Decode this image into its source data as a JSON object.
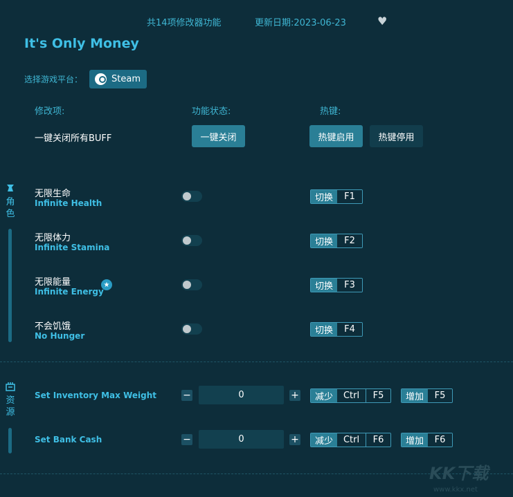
{
  "header": {
    "feature_count": "共14项修改器功能",
    "update_date": "更新日期:2023-06-23",
    "favorite_icon": "heart-icon"
  },
  "game_title": "It's Only Money",
  "platform": {
    "label": "选择游戏平台：",
    "selected": "Steam"
  },
  "columns": {
    "mod_item": "修改项:",
    "status": "功能状态:",
    "hotkey": "热键:"
  },
  "global": {
    "label": "一键关闭所有BUFF",
    "close_all": "一键关闭",
    "hotkey_enable": "热键启用",
    "hotkey_disable": "热键停用"
  },
  "categories": {
    "character": {
      "label_1": "角",
      "label_2": "色",
      "icon": "character-icon"
    },
    "resources": {
      "label_1": "资",
      "label_2": "源",
      "icon": "resources-icon"
    }
  },
  "features": [
    {
      "cn": "无限生命",
      "en": "Infinite Health",
      "on": false,
      "action": "切换",
      "key": "F1"
    },
    {
      "cn": "无限体力",
      "en": "Infinite Stamina",
      "on": false,
      "action": "切换",
      "key": "F2"
    },
    {
      "cn": "无限能量",
      "en": "Infinite Energy",
      "on": false,
      "action": "切换",
      "key": "F3",
      "star": "★"
    },
    {
      "cn": "不会饥饿",
      "en": "No Hunger",
      "on": false,
      "action": "切换",
      "key": "F4"
    }
  ],
  "numeric": [
    {
      "label": "Set Inventory Max Weight",
      "value": "0",
      "minus": "−",
      "plus": "+",
      "dec_action": "减少",
      "dec_mod": "Ctrl",
      "dec_key": "F5",
      "inc_action": "增加",
      "inc_key": "F5"
    },
    {
      "label": "Set Bank Cash",
      "value": "0",
      "minus": "−",
      "plus": "+",
      "dec_action": "减少",
      "dec_mod": "Ctrl",
      "dec_key": "F6",
      "inc_action": "增加",
      "inc_key": "F6"
    }
  ],
  "watermark": {
    "logo": "KK下载",
    "url": "www.kkx.net"
  },
  "colors": {
    "background": "#0d2d3a",
    "accent": "#3fbfe5",
    "button": "#2a7f96"
  }
}
